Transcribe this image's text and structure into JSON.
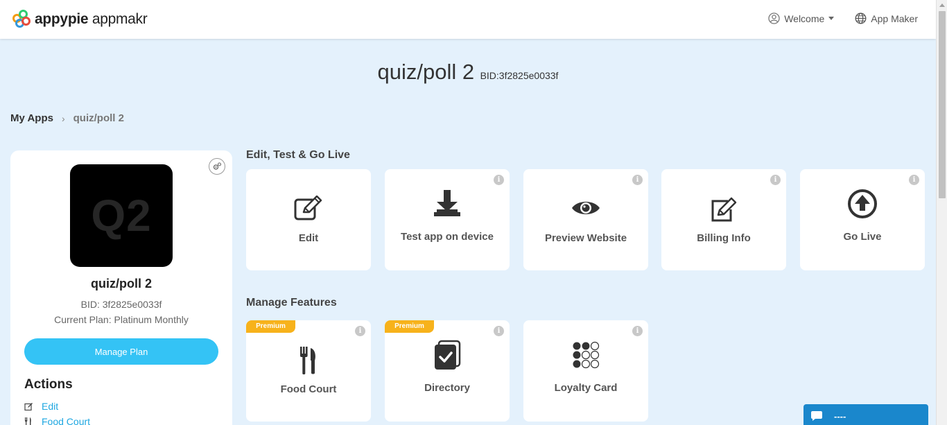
{
  "header": {
    "brand_bold": "appypie",
    "brand_light": "appmakr",
    "welcome_label": "Welcome",
    "app_maker_label": "App Maker"
  },
  "title": {
    "app_name": "quiz/poll 2",
    "bid": "BID:3f2825e0033f"
  },
  "breadcrumb": {
    "root": "My Apps",
    "separator": "›",
    "current": "quiz/poll 2"
  },
  "panel": {
    "icon_text": "Q2",
    "app_name": "quiz/poll 2",
    "bid_line": "BID: 3f2825e0033f",
    "plan_line": "Current Plan: Platinum Monthly",
    "manage_plan_label": "Manage Plan",
    "actions_title": "Actions",
    "actions": [
      {
        "label": "Edit",
        "icon": "edit-icon"
      },
      {
        "label": "Food Court",
        "icon": "fork-knife-icon"
      }
    ]
  },
  "sections": {
    "edit_test_title": "Edit, Test & Go Live",
    "manage_features_title": "Manage Features"
  },
  "edit_cards": [
    {
      "label": "Edit",
      "icon": "edit-icon",
      "has_info": false
    },
    {
      "label": "Test app on device",
      "icon": "download-icon",
      "has_info": true
    },
    {
      "label": "Preview Website",
      "icon": "eye-icon",
      "has_info": true
    },
    {
      "label": "Billing Info",
      "icon": "billing-edit-icon",
      "has_info": true
    },
    {
      "label": "Go Live",
      "icon": "upload-arrow-icon",
      "has_info": true
    }
  ],
  "feature_cards": [
    {
      "label": "Food Court",
      "icon": "fork-knife-icon",
      "badge": "Premium"
    },
    {
      "label": "Directory",
      "icon": "directory-icon",
      "badge": "Premium"
    },
    {
      "label": "Loyalty Card",
      "icon": "loyalty-dots-icon",
      "badge": ""
    }
  ],
  "info_glyph": "i",
  "chat": {
    "label": "----"
  },
  "colors": {
    "page_bg": "#e4f1fc",
    "accent": "#34c3f5",
    "link": "#1ea7e1",
    "premium": "#f7b21b",
    "chat": "#1a87cc"
  }
}
